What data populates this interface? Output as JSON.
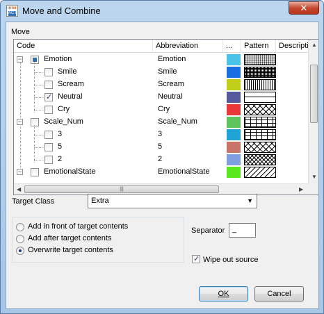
{
  "window": {
    "title": "Move and Combine",
    "close_glyph": "✕",
    "app_icon": {
      "line1": "inter",
      "line2": "ACT"
    }
  },
  "move_group": {
    "label": "Move",
    "columns": [
      "Code",
      "Abbreviation",
      "...",
      "Pattern",
      "Description"
    ],
    "rows": [
      {
        "code": "Emotion",
        "abbr": "Emotion",
        "level": 0,
        "expander": "−",
        "check": "partial",
        "color": "#4bc3e6",
        "pattern": "dots"
      },
      {
        "code": "Smile",
        "abbr": "Smile",
        "level": 1,
        "check": "off",
        "color": "#1a6fe0",
        "pattern": "grid"
      },
      {
        "code": "Scream",
        "abbr": "Scream",
        "level": 1,
        "check": "off",
        "color": "#c2cf17",
        "pattern": "vlines"
      },
      {
        "code": "Neutral",
        "abbr": "Neutral",
        "level": 1,
        "check": "on",
        "color": "#545a9c",
        "pattern": "hline"
      },
      {
        "code": "Cry",
        "abbr": "Cry",
        "level": 1,
        "check": "off",
        "color": "#e83838",
        "pattern": "diagcross"
      },
      {
        "code": "Scale_Num",
        "abbr": "Scale_Num",
        "level": 0,
        "expander": "−",
        "check": "off",
        "color": "#5cc45c",
        "pattern": "bricks"
      },
      {
        "code": "3",
        "abbr": "3",
        "level": 1,
        "check": "off",
        "color": "#1ea3d4",
        "pattern": "bricks"
      },
      {
        "code": "5",
        "abbr": "5",
        "level": 1,
        "check": "off",
        "color": "#c87468",
        "pattern": "diagcross"
      },
      {
        "code": "2",
        "abbr": "2",
        "level": 1,
        "check": "off",
        "color": "#7f9ee0",
        "pattern": "xhatch"
      },
      {
        "code": "EmotionalState",
        "abbr": "EmotionalState",
        "level": 0,
        "expander": "−",
        "check": "off",
        "color": "#58e81c",
        "pattern": "diag"
      }
    ],
    "hscroll_grip": "|||",
    "up_arrow": "▲",
    "down_arrow": "▼",
    "left_arrow": "◀",
    "right_arrow": "▶"
  },
  "target_class": {
    "label": "Target Class",
    "value": "Extra",
    "caret": "▼"
  },
  "placement": {
    "options": [
      "Add in front of target contents",
      "Add after target contents",
      "Overwrite target contents"
    ],
    "selected_index": 2
  },
  "separator": {
    "label": "Separator",
    "value": "_"
  },
  "wipe_out": {
    "label": "Wipe out source",
    "checked": true,
    "check_glyph": "✓"
  },
  "buttons": {
    "ok": "OK",
    "cancel": "Cancel"
  }
}
